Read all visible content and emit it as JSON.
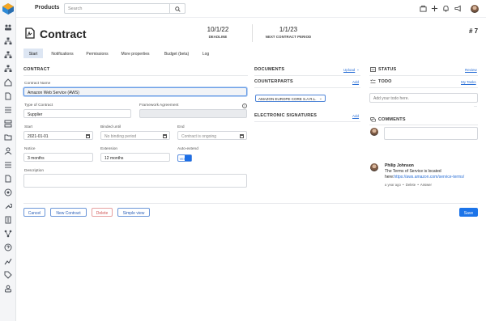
{
  "topbar": {
    "title": "Products",
    "search_placeholder": "Search"
  },
  "header": {
    "title": "Contract",
    "deadline_value": "10/1/22",
    "deadline_label": "DEADLINE",
    "next_period_value": "1/1/23",
    "next_period_label": "NEXT CONTRACT PERIOD",
    "number": "# 7"
  },
  "tabs": [
    "Start",
    "Notifications",
    "Permissions",
    "More properties",
    "Budget (beta)",
    "Log"
  ],
  "contract": {
    "section": "CONTRACT",
    "name_label": "Contract Name",
    "name_value": "Amazon Web Service (AWS)",
    "type_label": "Type of Contract",
    "type_value": "Supplier",
    "framework_label": "Framework Agreement",
    "framework_value": "",
    "start_label": "Start",
    "start_value": "2021-01-01",
    "binded_label": "Binded until",
    "binded_placeholder": "No binding period",
    "end_label": "End",
    "end_placeholder": "Contract is ongoing",
    "notice_label": "Notice",
    "notice_value": "3 months",
    "extension_label": "Extension",
    "extension_value": "12 months",
    "autoextend_label": "Auto-extend",
    "autoextend_value": "YES",
    "description_label": "Description",
    "description_value": ""
  },
  "buttons": {
    "cancel": "Cancel",
    "new_contract": "New Contract",
    "delete": "Delete",
    "simple_view": "Simple view",
    "save": "Save"
  },
  "documents": {
    "title": "DOCUMENTS",
    "upload": "Upload"
  },
  "counterparts": {
    "title": "COUNTERPARTS",
    "add": "Add",
    "selected": "AMAZON EUROPE CORE S.A R.L."
  },
  "signatures": {
    "title": "ELECTRONIC SIGNATURES",
    "add": "Add"
  },
  "status": {
    "title": "STATUS",
    "review": "Review"
  },
  "todo": {
    "title": "TODO",
    "my_tasks": "My Tasks",
    "placeholder": "Add your todo here."
  },
  "comments": {
    "title": "COMMENTS",
    "author": "Philip Johnson",
    "text": "The Terms of Service is located here:",
    "url": "https://aws.amazon.com/service-terms/",
    "time": "a year ago",
    "delete": "Delete",
    "answer": "Answer"
  },
  "icons": [
    "people-icon",
    "hierarchy-icon",
    "hierarchy-icon",
    "hierarchy-icon",
    "home-icon",
    "document-icon",
    "list-icon",
    "server-icon",
    "folder-icon",
    "user-icon",
    "list-icon",
    "document-icon",
    "target-icon",
    "wrench-icon",
    "building-icon",
    "network-icon",
    "help-icon",
    "chart-icon",
    "tag-icon",
    "team-icon"
  ],
  "colors": {
    "accent": "#1c74e9",
    "danger": "#d05454",
    "tab_active": "#dde6f3"
  }
}
